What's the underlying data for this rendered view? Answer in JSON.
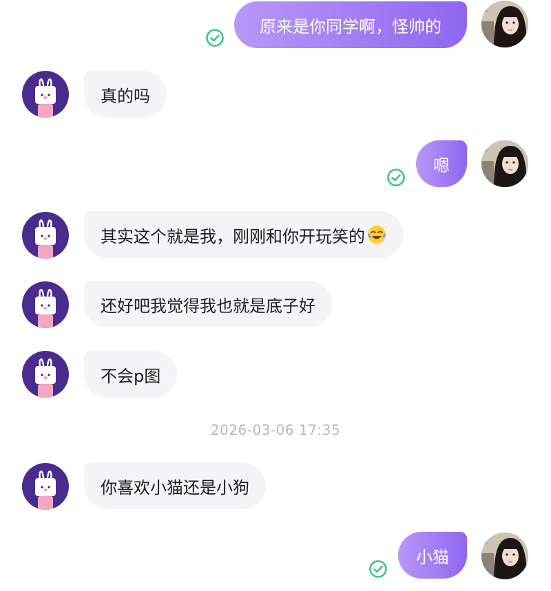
{
  "messages": [
    {
      "side": "out",
      "text": "原来是你同学啊，怪帅的",
      "status": "read"
    },
    {
      "side": "in",
      "text": "真的吗"
    },
    {
      "side": "out",
      "text": "嗯",
      "status": "read"
    },
    {
      "side": "in",
      "text": "其实这个就是我，刚刚和你开玩笑的",
      "emoji": "😂"
    },
    {
      "side": "in",
      "text": "还好吧我觉得我也就是底子好"
    },
    {
      "side": "in",
      "text": "不会p图"
    },
    {
      "side": "in",
      "text": "你喜欢小猫还是小狗"
    },
    {
      "side": "out",
      "text": "小猫",
      "status": "read"
    }
  ],
  "timestamp": "2026-03-06 17:35",
  "icons": {
    "read_receipt": "check-circle-icon",
    "laugh_emoji": "face-with-tears-of-joy-icon"
  },
  "colors": {
    "bubble_out_start": "#b898f8",
    "bubble_out_end": "#8f66f0",
    "bubble_in": "#f4f4f6",
    "check": "#3cc38a",
    "timestamp": "#b8b8bc",
    "bot_avatar_bg": "#4a2c8f"
  }
}
